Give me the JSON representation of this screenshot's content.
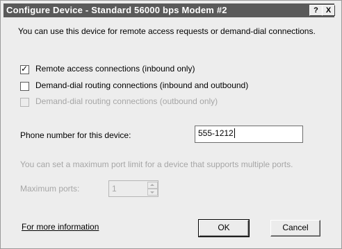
{
  "window": {
    "title": "Configure Device - Standard 56000 bps Modem #2",
    "help_button": "?",
    "close_button": "X"
  },
  "description": "You can use this device for remote access requests or demand-dial connections.",
  "options": [
    {
      "label": "Remote access connections (inbound only)",
      "checked": true,
      "enabled": true
    },
    {
      "label": "Demand-dial routing connections (inbound and outbound)",
      "checked": false,
      "enabled": true
    },
    {
      "label": "Demand-dial routing connections (outbound only)",
      "checked": false,
      "enabled": false
    }
  ],
  "phone": {
    "label": "Phone number for this device:",
    "value": "555-1212"
  },
  "ports": {
    "hint": "You can set a maximum port limit for a device that supports multiple ports.",
    "label": "Maximum ports:",
    "value": "1"
  },
  "footer": {
    "link": "For more information",
    "ok": "OK",
    "cancel": "Cancel"
  }
}
